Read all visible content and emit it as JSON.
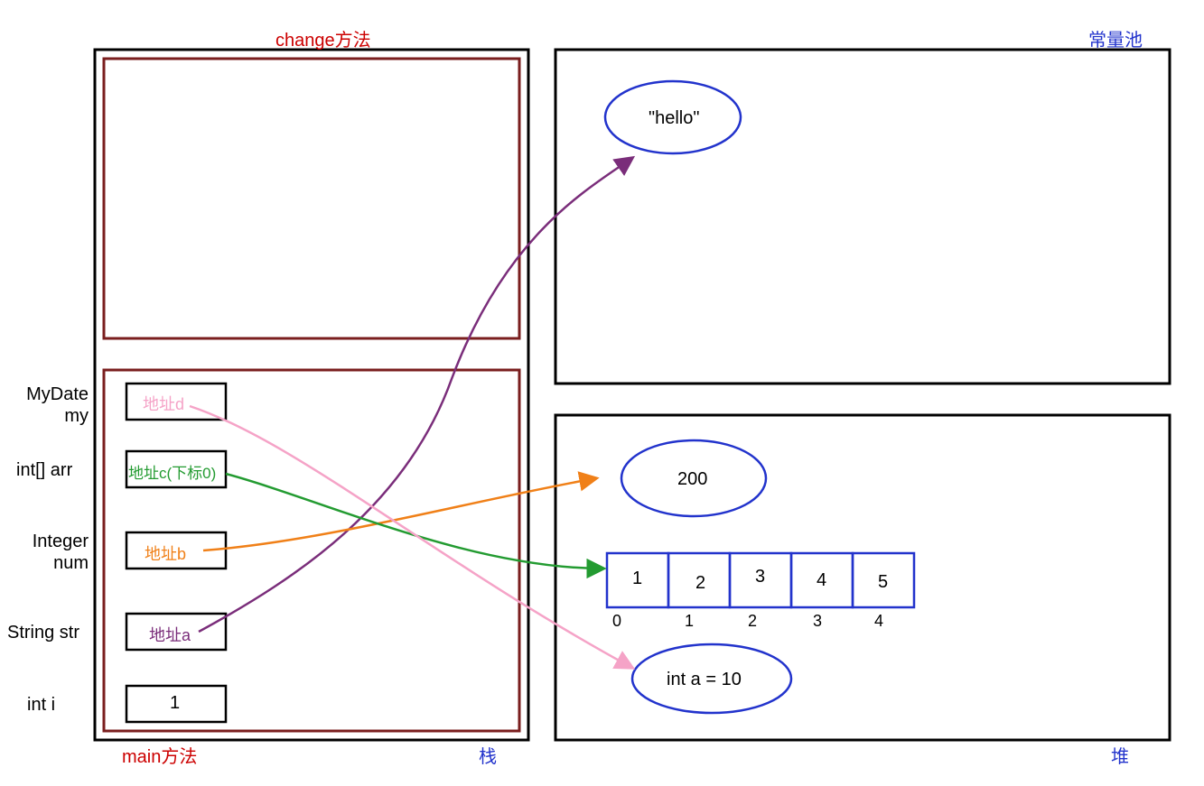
{
  "titles": {
    "change_method": "change方法",
    "main_method": "main方法",
    "stack": "栈",
    "heap": "堆",
    "constant_pool": "常量池"
  },
  "stack_vars": {
    "mydate": {
      "label": "MyDate my",
      "box": "地址d"
    },
    "intarr": {
      "label": "int[] arr",
      "box": "地址c(下标0)"
    },
    "integer": {
      "label": "Integer num",
      "box": "地址b"
    },
    "string": {
      "label": "String str",
      "box": "地址a"
    },
    "inti": {
      "label": "int i",
      "box": "1"
    }
  },
  "heap_objects": {
    "hello": "\"hello\"",
    "integer200": "200",
    "mydate_obj": "int a = 10"
  },
  "array": {
    "values": [
      "1",
      "2",
      "3",
      "4",
      "5"
    ],
    "indices": [
      "0",
      "1",
      "2",
      "3",
      "4"
    ]
  },
  "colors": {
    "red": "#cc0000",
    "darkred": "#7a1e1e",
    "blue": "#2233cc",
    "black": "#000000",
    "pink": "#f5a3c7",
    "green": "#239b31",
    "orange": "#f08018",
    "purple": "#7a2d7a"
  }
}
